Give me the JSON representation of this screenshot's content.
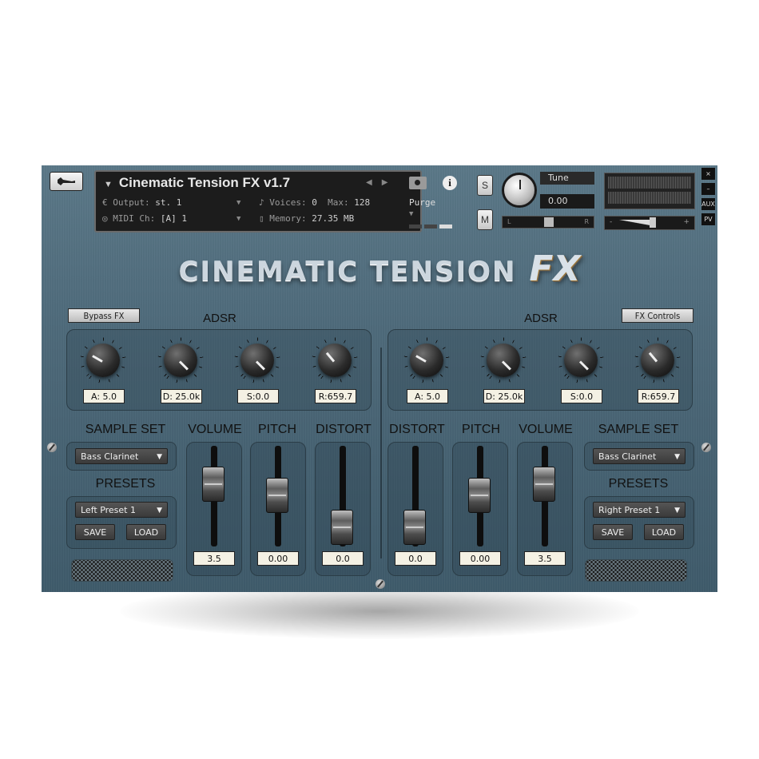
{
  "instrument": {
    "title": "Cinematic Tension FX v1.7",
    "output_label": "Output:",
    "output_value": "st. 1",
    "midi_label": "MIDI Ch:",
    "midi_value": "[A]  1",
    "voices_label": "Voices:",
    "voices_value": "0",
    "max_label": "Max:",
    "max_value": "128",
    "memory_label": "Memory:",
    "memory_value": "27.35 MB",
    "purge_label": "Purge",
    "solo_label": "S",
    "mute_label": "M",
    "tune_label": "Tune",
    "tune_value": "0.00",
    "pan_left": "L",
    "pan_right": "R",
    "vol_minus": "-",
    "vol_plus": "+",
    "close": "×",
    "minimize": "–",
    "aux": "AUX",
    "pv": "PV"
  },
  "logo": {
    "main": "CINEMATIC TENSION",
    "fx": "FX"
  },
  "left": {
    "bypass_label": "Bypass FX",
    "adsr_label": "ADSR",
    "adsr_values": [
      "A:  5.0",
      "D: 25.0k",
      "S:0.0",
      "R:659.7"
    ],
    "sample_set_label": "SAMPLE SET",
    "sample_set_value": "Bass Clarinet",
    "presets_label": "PRESETS",
    "preset_value": "Left Preset 1",
    "save_label": "SAVE",
    "load_label": "LOAD",
    "faders": [
      {
        "label": "VOLUME",
        "value": "3.5"
      },
      {
        "label": "PITCH",
        "value": "0.00"
      },
      {
        "label": "DISTORT",
        "value": "0.0"
      }
    ]
  },
  "right": {
    "fx_controls_label": "FX Controls",
    "adsr_label": "ADSR",
    "adsr_values": [
      "A:  5.0",
      "D: 25.0k",
      "S:0.0",
      "R:659.7"
    ],
    "sample_set_label": "SAMPLE SET",
    "sample_set_value": "Bass Clarinet",
    "presets_label": "PRESETS",
    "preset_value": "Right Preset 1",
    "save_label": "SAVE",
    "load_label": "LOAD",
    "faders": [
      {
        "label": "DISTORT",
        "value": "0.0"
      },
      {
        "label": "PITCH",
        "value": "0.00"
      },
      {
        "label": "VOLUME",
        "value": "3.5"
      }
    ]
  },
  "colors": {
    "panel": "#4c6878",
    "display": "#1c1c1c",
    "value_box": "#f4f1e4"
  }
}
